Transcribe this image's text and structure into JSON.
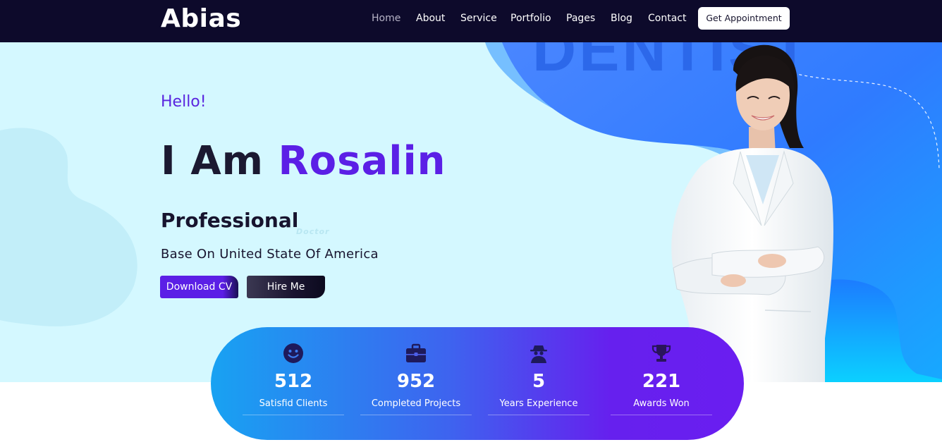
{
  "brand": {
    "logo": "Abias"
  },
  "nav": {
    "items": [
      {
        "label": "Home",
        "active": true
      },
      {
        "label": "About",
        "active": false
      },
      {
        "label": "Service",
        "active": false
      },
      {
        "label": "Portfolio",
        "active": false
      },
      {
        "label": "Pages",
        "active": false
      },
      {
        "label": "Blog",
        "active": false
      },
      {
        "label": "Contact",
        "active": false
      }
    ],
    "cta_label": "Get Appointment"
  },
  "hero": {
    "greeting": "Hello!",
    "headline_prefix": "I Am ",
    "name": "Rosalin",
    "role": "Professional",
    "role_ghost": "Doctor",
    "background_word": "DENTIST",
    "location": "Base On United State Of America",
    "download_label": "Download CV",
    "hire_label": "Hire Me"
  },
  "stats": [
    {
      "icon": "smile-icon",
      "value": "512",
      "label": "Satisfid Clients"
    },
    {
      "icon": "briefcase-icon",
      "value": "952",
      "label": "Completed Projects"
    },
    {
      "icon": "spy-user-icon",
      "value": "5",
      "label": "Years Experience"
    },
    {
      "icon": "trophy-icon",
      "value": "221",
      "label": "Awards Won"
    }
  ],
  "colors": {
    "navbar": "#0d0a2b",
    "hero_bg": "#d4f8ff",
    "accent_purple": "#5b1fe6",
    "stats_gradient_start": "#18a2f2",
    "stats_gradient_end": "#6a1ef0",
    "icon_dark": "#1e1a5c"
  }
}
